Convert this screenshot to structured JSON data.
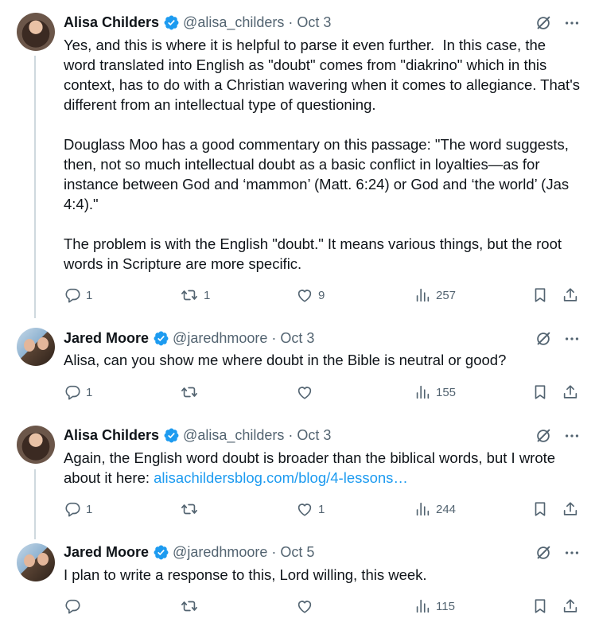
{
  "tweets": [
    {
      "name": "Alisa Childers",
      "handle": "@alisa_childers",
      "date": "Oct 3",
      "text": "Yes, and this is where it is helpful to parse it even further.  In this case, the word translated into English as \"doubt\" comes from \"diakrino\" which in this context, has to do with a Christian wavering when it comes to allegiance. That's different from an intellectual type of questioning.\n\nDouglass Moo has a good commentary on this passage: \"The word suggests, then, not so much intellectual doubt as a basic conflict in loyalties—as for instance between God and ‘mammon’ (Matt. 6:24) or God and ‘the world’ (Jas 4:4).\"\n\nThe problem is with the English \"doubt.\" It means various things, but the root words in Scripture are more specific.",
      "link": "",
      "replies": "1",
      "retweets": "1",
      "likes": "9",
      "views": "257"
    },
    {
      "name": "Jared Moore",
      "handle": "@jaredhmoore",
      "date": "Oct 3",
      "text": "Alisa, can you show me where doubt in the Bible is neutral or good?",
      "link": "",
      "replies": "1",
      "retweets": "",
      "likes": "",
      "views": "155"
    },
    {
      "name": "Alisa Childers",
      "handle": "@alisa_childers",
      "date": "Oct 3",
      "text": "Again, the English word doubt is broader than the biblical words, but I wrote about it here: ",
      "link": "alisachildersblog.com/blog/4-lessons…",
      "replies": "1",
      "retweets": "",
      "likes": "1",
      "views": "244"
    },
    {
      "name": "Jared Moore",
      "handle": "@jaredhmoore",
      "date": "Oct 5",
      "text": "I plan to write a response to this, Lord willing, this week.",
      "link": "",
      "replies": "",
      "retweets": "",
      "likes": "",
      "views": "115"
    }
  ],
  "icons": {
    "verified": "verified-badge-icon",
    "grok": "grok-icon",
    "more": "more-icon",
    "reply": "reply-icon",
    "retweet": "retweet-icon",
    "like": "like-icon",
    "views": "views-icon",
    "bookmark": "bookmark-icon",
    "share": "share-icon"
  },
  "colors": {
    "text": "#0f1419",
    "secondary": "#536471",
    "link": "#1d9bf0",
    "verified": "#1d9bf0",
    "thread_line": "#cfd9de"
  }
}
